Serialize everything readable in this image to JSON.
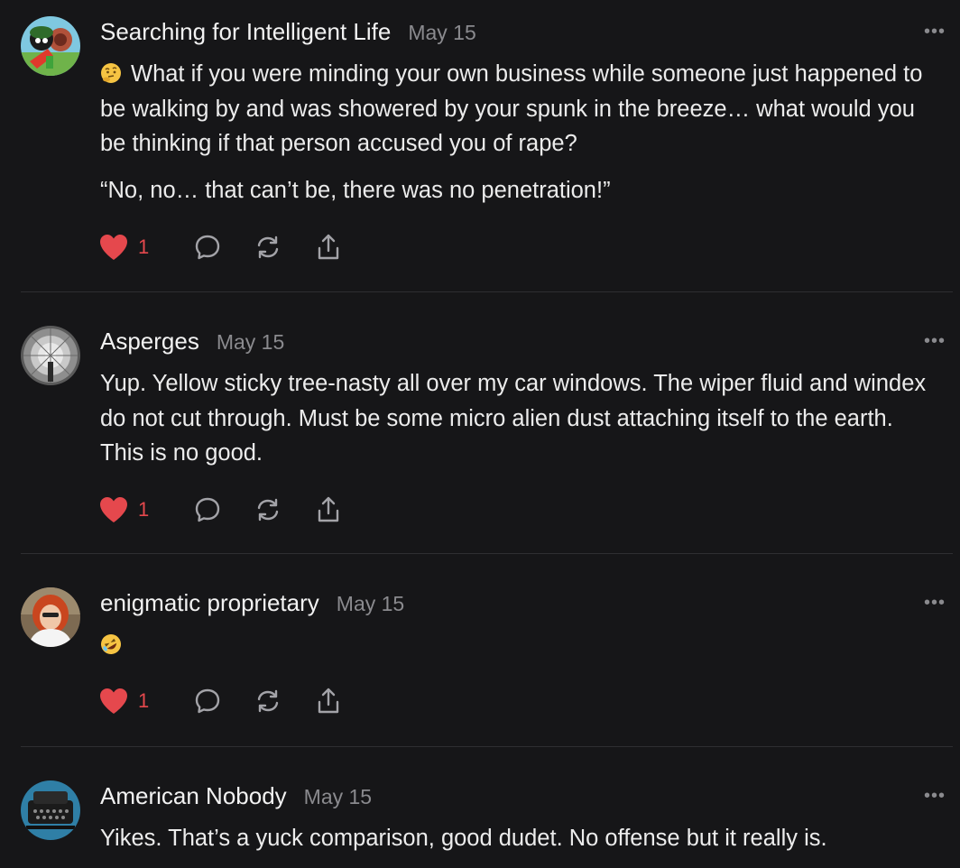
{
  "comments": [
    {
      "author": "Searching for Intelligent Life",
      "date": "May 15",
      "body_emoji": "thinking-face-emoji",
      "paragraphs": [
        "What if you were minding your own business while someone just happened to be walking by and was showered by your spunk in the breeze… what would you be thinking if that person accused you of rape?",
        "“No, no… that can’t be, there was no penetration!”"
      ],
      "likes": "1",
      "more": "•••"
    },
    {
      "author": "Asperges",
      "date": "May 15",
      "paragraphs": [
        "Yup. Yellow sticky tree-nasty all over my car windows. The wiper fluid and windex do not cut through. Must be some micro alien dust attaching itself to the earth. This is no good."
      ],
      "likes": "1",
      "more": "•••"
    },
    {
      "author": "enigmatic proprietary",
      "date": "May 15",
      "body_emoji": "rolling-on-floor-laughing-emoji",
      "paragraphs": [],
      "likes": "1",
      "more": "•••"
    },
    {
      "author": "American Nobody",
      "date": "May 15",
      "paragraphs": [
        "Yikes. That’s a yuck comparison, good dudet. No offense but it really is."
      ],
      "more": "•••"
    }
  ],
  "colors": {
    "background": "#161618",
    "heart": "#e5484d",
    "muted": "#8a8a8e",
    "divider": "#2e2e31"
  },
  "icons": [
    "heart-icon",
    "comment-icon",
    "restack-icon",
    "share-icon",
    "more-icon"
  ]
}
